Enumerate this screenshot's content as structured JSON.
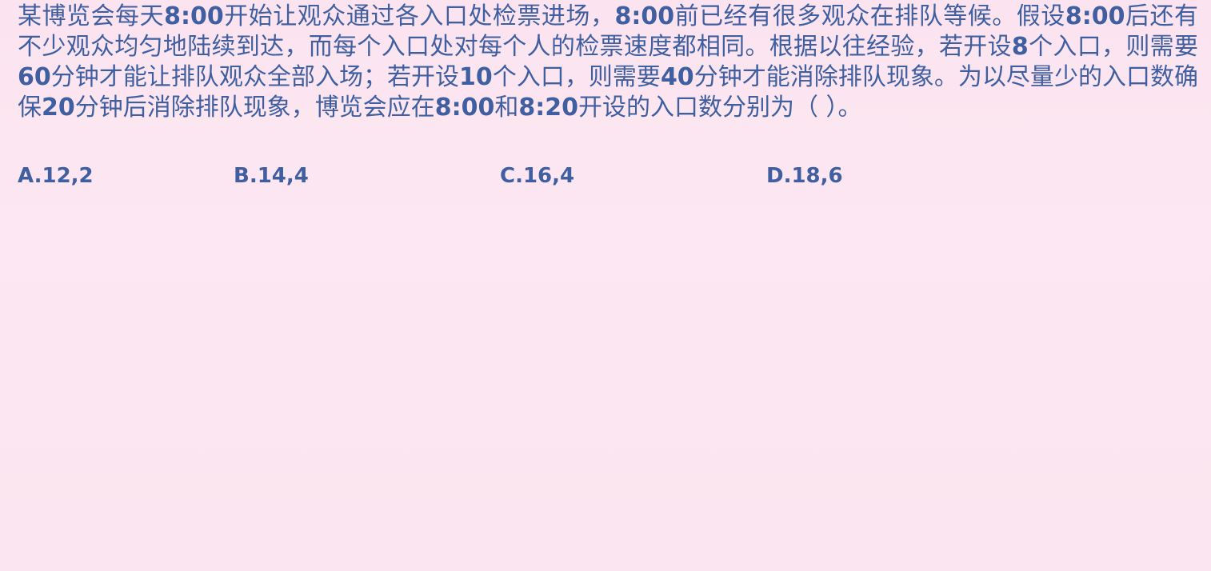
{
  "question": {
    "segments": [
      {
        "text": "某博览会每天",
        "bold": false
      },
      {
        "text": "8:00",
        "bold": true
      },
      {
        "text": "开始让观众通过各入口处检票进场，",
        "bold": false
      },
      {
        "text": "8:00",
        "bold": true
      },
      {
        "text": "前已经有很多观众在排队等候。假设",
        "bold": false
      },
      {
        "text": "8:00",
        "bold": true
      },
      {
        "text": "后还有不少观众均匀地陆续到达，而每个入口处对每个人的检票速度都相同。根据以往经验，若开设",
        "bold": false
      },
      {
        "text": "8",
        "bold": true
      },
      {
        "text": "个入口，则需要",
        "bold": false
      },
      {
        "text": "60",
        "bold": true
      },
      {
        "text": "分钟才能让排队观众全部入场；若开设",
        "bold": false
      },
      {
        "text": "10",
        "bold": true
      },
      {
        "text": "个入口，则需要",
        "bold": false
      },
      {
        "text": "40",
        "bold": true
      },
      {
        "text": "分钟才能消除排队现象。为以尽量少的入口数确保",
        "bold": false
      },
      {
        "text": "20",
        "bold": true
      },
      {
        "text": "分钟后消除排队现象，博览会应在",
        "bold": false
      },
      {
        "text": "8:00",
        "bold": true
      },
      {
        "text": "和",
        "bold": false
      },
      {
        "text": "8:20",
        "bold": true
      },
      {
        "text": "开设的入口数分别为（ ）。",
        "bold": false
      }
    ]
  },
  "options": {
    "a": "A.12,2",
    "b": "B.14,4",
    "c": "C.16,4",
    "d": "D.18,6"
  },
  "colors": {
    "background": "#fbe6f1",
    "text": "#3f5fa0"
  }
}
